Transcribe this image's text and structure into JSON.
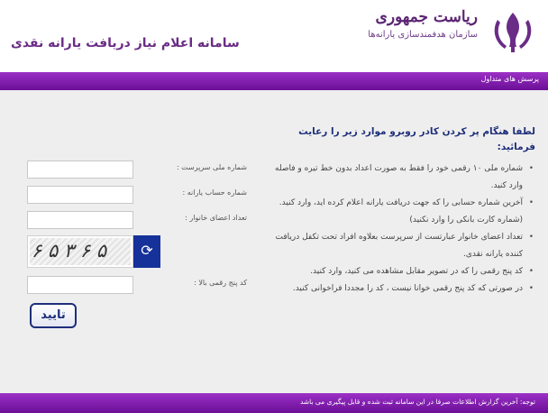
{
  "header": {
    "org_title": "ریاست جمهوری",
    "org_subtitle": "سازمان هدفمندسازی یارانه‌ها",
    "site_title": "سامانه اعلام نیاز دریافت یارانه نقدی"
  },
  "nav": {
    "track_link": "پرسش های متداول"
  },
  "intro": {
    "heading": "لطفا هنگام پر کردن کادر روبرو موارد زیر را رعایت فرمائید:"
  },
  "rules": [
    "شماره ملی ۱۰ رقمی خود را فقط به صورت اعداد بدون خط تیره و فاصله وارد کنید.",
    "آخرین شماره حسابی را که جهت دریافت یارانه اعلام کرده اید، وارد کنید. (شماره کارت بانکی را وارد نکنید)",
    "تعداد اعضای خانوار عبارتست از سرپرست بعلاوه افراد تحت تکفل دریافت کننده یارانه نقدی.",
    "کد پنج رقمی را که در تصویر مقابل مشاهده می کنید، وارد کنید.",
    "در صورتی که کد پنج رقمی خوانا نیست ، کد را مجددا فراخوانی کنید."
  ],
  "form": {
    "national_id_label": "شماره ملی سرپرست :",
    "account_label": "شماره حساب یارانه :",
    "members_label": "تعداد اعضای خانوار :",
    "captcha_text": "۶ ۵ ۳ ۶ ۵",
    "code_label": "کد پنج رقمی بالا :",
    "submit_label": "تایید"
  },
  "footer": {
    "text": "توجه: آخرین گزارش اطلاعات صرفا در این سامانه ثبت شده و قابل پیگیری می باشد"
  },
  "colors": {
    "brand_purple": "#7b1fa8",
    "heading_blue": "#1e2f7a",
    "refresh_blue": "#16319a"
  }
}
